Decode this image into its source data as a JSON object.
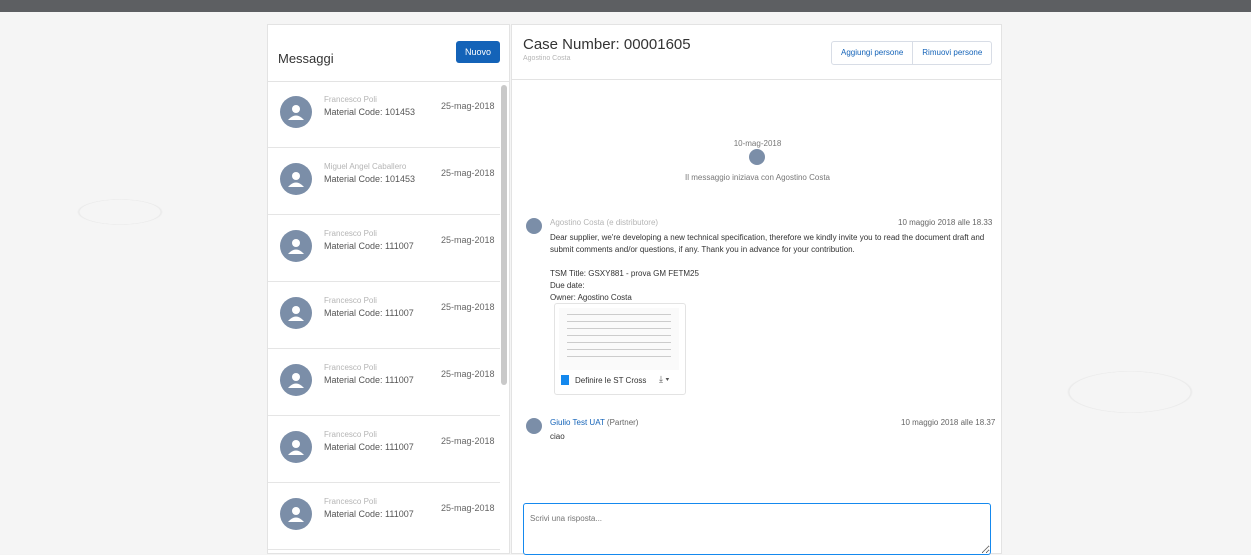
{
  "sidebar": {
    "title": "Messaggi",
    "new_button": "Nuovo",
    "items": [
      {
        "name": "Francesco Poli",
        "code": "Material Code: 101453",
        "date": "25-mag-2018"
      },
      {
        "name": "Miguel Angel Caballero",
        "code": "Material Code: 101453",
        "date": "25-mag-2018"
      },
      {
        "name": "Francesco Poli",
        "code": "Material Code: 111007",
        "date": "25-mag-2018"
      },
      {
        "name": "Francesco Poli",
        "code": "Material Code: 111007",
        "date": "25-mag-2018"
      },
      {
        "name": "Francesco Poli",
        "code": "Material Code: 111007",
        "date": "25-mag-2018"
      },
      {
        "name": "Francesco Poli",
        "code": "Material Code: 111007",
        "date": "25-mag-2018"
      },
      {
        "name": "Francesco Poli",
        "code": "Material Code: 111007",
        "date": "25-mag-2018"
      }
    ]
  },
  "header": {
    "case_number": "Case Number: 00001605",
    "owner": "Agostino Costa",
    "add_people": "Aggiungi persone",
    "remove_people": "Rimuovi persone"
  },
  "thread": {
    "start_date": "10-mag-2018",
    "start_text": "Il messaggio iniziava con Agostino Costa",
    "msg1": {
      "sender": "Agostino Costa (e distributore)",
      "time": "10 maggio 2018 alle 18.33",
      "line1": "Dear supplier, we're developing a new technical specification, therefore we kindly invite you to read the document draft and",
      "line2": "submit comments and/or questions, if any. Thank you in advance for your contribution.",
      "tsm": "TSM Title: GSXY881 - prova GM FETM25",
      "due": "Due date:",
      "owner": "Owner: Agostino Costa",
      "attachment": "Definire le ST Cross"
    },
    "msg2": {
      "sender": "Giulio Test UAT",
      "role": " (Partner)",
      "time": "10 maggio 2018 alle 18.37",
      "text": "ciao"
    }
  },
  "reply": {
    "placeholder": "Scrivi una risposta..."
  }
}
